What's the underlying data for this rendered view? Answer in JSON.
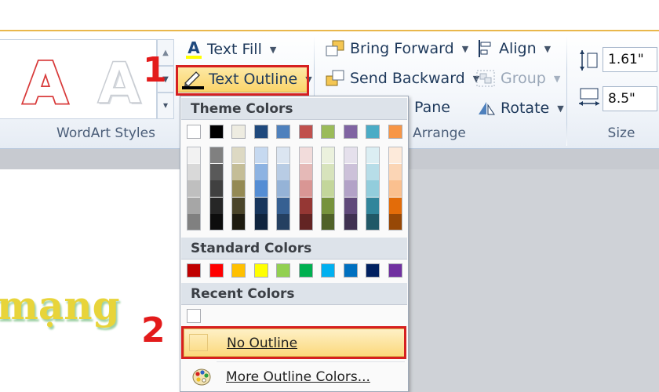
{
  "ribbon": {
    "wordart_group_label": "WordArt Styles",
    "text_fill_label": "Text Fill",
    "text_outline_label": "Text Outline",
    "bring_forward_label": "Bring Forward",
    "send_backward_label": "Send Backward",
    "selection_pane_label": "Pane",
    "arrange_group_label": "Arrange",
    "align_label": "Align",
    "group_label": "Group",
    "rotate_label": "Rotate",
    "size_group_label": "Size",
    "height_value": "1.61\"",
    "width_value": "8.5\""
  },
  "menu": {
    "theme_colors_heading": "Theme Colors",
    "standard_colors_heading": "Standard Colors",
    "recent_colors_heading": "Recent Colors",
    "no_outline_label": "No Outline",
    "more_colors_label": "More Outline Colors...",
    "theme_top_row": [
      "#ffffff",
      "#000000",
      "#eeece1",
      "#1f497d",
      "#4f81bd",
      "#c0504d",
      "#9bbb59",
      "#8064a2",
      "#4bacc6",
      "#f79646"
    ],
    "theme_shades": [
      [
        "#f2f2f2",
        "#d9d9d9",
        "#bfbfbf",
        "#a6a6a6",
        "#808080"
      ],
      [
        "#808080",
        "#595959",
        "#404040",
        "#262626",
        "#0d0d0d"
      ],
      [
        "#ddd9c3",
        "#c4bd97",
        "#948a54",
        "#4a452a",
        "#1d1b10"
      ],
      [
        "#c6d9f0",
        "#8db3e2",
        "#548dd4",
        "#17365d",
        "#0f243e"
      ],
      [
        "#dbe5f1",
        "#b8cce4",
        "#95b3d7",
        "#366092",
        "#244061"
      ],
      [
        "#f2dcdb",
        "#e5b9b7",
        "#d99694",
        "#953734",
        "#632423"
      ],
      [
        "#ebf1dd",
        "#d7e3bc",
        "#c3d69b",
        "#76923c",
        "#4f6128"
      ],
      [
        "#e5e0ec",
        "#ccc1d9",
        "#b2a2c7",
        "#5f497a",
        "#3f3151"
      ],
      [
        "#dbeef3",
        "#b7dde8",
        "#92cddc",
        "#31859b",
        "#205867"
      ],
      [
        "#fdeada",
        "#fbd5b5",
        "#fac08f",
        "#e36c09",
        "#974806"
      ]
    ],
    "standard_colors": [
      "#c00000",
      "#ff0000",
      "#ffc000",
      "#ffff00",
      "#92d050",
      "#00b050",
      "#00b0f0",
      "#0070c0",
      "#002060",
      "#7030a0"
    ],
    "recent_colors": [
      "#ffffff"
    ]
  },
  "slide": {
    "text": "mạng"
  },
  "annotations": {
    "step1": "1",
    "step2": "2"
  },
  "colors": {
    "accent_red": "#d62020",
    "wordart_red": "#d83a3a",
    "highlight": "#fbd97c"
  }
}
